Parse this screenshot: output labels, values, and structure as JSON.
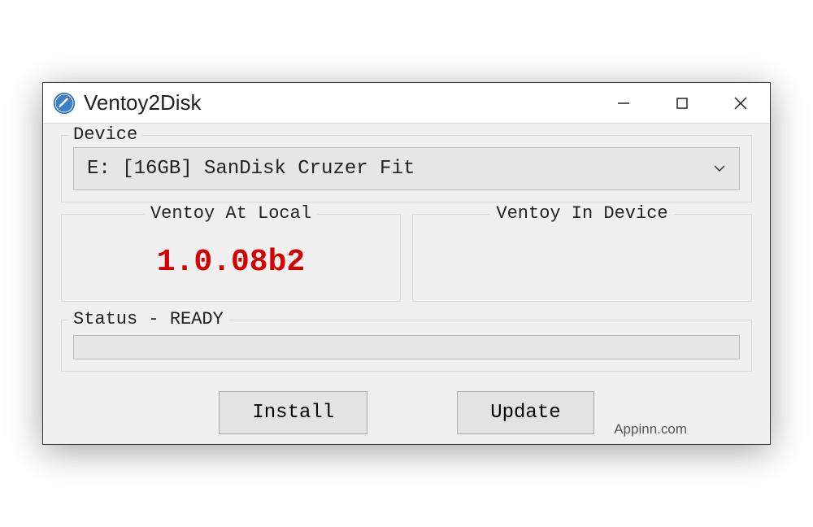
{
  "window": {
    "title": "Ventoy2Disk"
  },
  "device": {
    "group_label": "Device",
    "selected": "E: [16GB] SanDisk Cruzer Fit"
  },
  "versions": {
    "local_label": "Ventoy At Local",
    "local_value": "1.0.08b2",
    "device_label": "Ventoy In Device",
    "device_value": ""
  },
  "status": {
    "label": "Status - READY"
  },
  "buttons": {
    "install": "Install",
    "update": "Update"
  },
  "watermark": "Appinn.com"
}
